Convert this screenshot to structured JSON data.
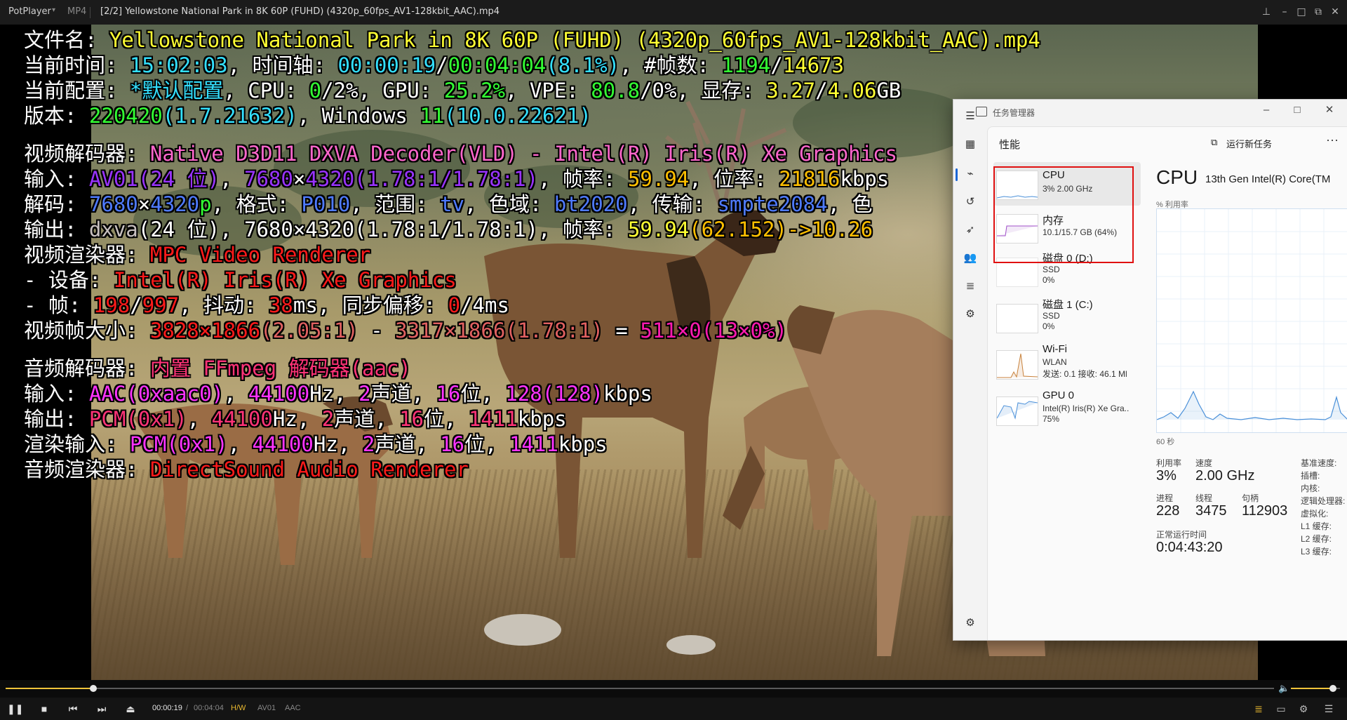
{
  "titlebar": {
    "app_name": "PotPlayer",
    "format": "MP4",
    "title": "[2/2] Yellowstone National Park in 8K 60P (FUHD) (4320p_60fps_AV1-128kbit_AAC).mp4"
  },
  "osd": {
    "filename": {
      "label": "文件名: ",
      "value": "Yellowstone National Park in 8K 60P (FUHD) (4320p_60fps_AV1-128kbit_AAC).mp4"
    },
    "time": {
      "label": "当前时间: ",
      "clock": "15:02:03",
      "sep1": ", 时间轴: ",
      "pos": "00:00:19",
      "slash": "/",
      "dur": "00:04:04",
      "pct": "(8.1%)",
      "sep2": ", #帧数: ",
      "frames": "1194",
      "slash2": "/",
      "total_frames": "14673"
    },
    "config": {
      "label": "当前配置: ",
      "preset": "*默认配置",
      "cpu_l": ", CPU: ",
      "cpu": "0",
      "cpu_s": "/2%",
      "gpu_l": ", GPU: ",
      "gpu": "25.2%",
      "vpe_l": ", VPE: ",
      "vpe": "80.8",
      "vpe_s": "/0%",
      "mem_l": ", 显存: ",
      "mem1": "3.27",
      "mem_sl": "/",
      "mem2": "4.06",
      "mem_u": "GB"
    },
    "version": {
      "label": "版本: ",
      "build": "220420",
      "ver": "(1.7.21632)",
      "os_l": ", Windows ",
      "os": "11",
      "os_ver": "(10.0.22621)"
    },
    "vdec": {
      "label": "视频解码器: ",
      "value": "Native D3D11 DXVA Decoder(VLD) - Intel(R) Iris(R) Xe Graphics"
    },
    "vin": {
      "label": "输入: ",
      "codec": "AV01",
      "bits": "(24 位)",
      "c1": ", ",
      "w": "7680",
      "x": "×",
      "h": "4320",
      "ar": "(1.78:1/1.78:1)",
      "fr_l": ", 帧率: ",
      "fr": "59.94",
      "br_l": ", 位率: ",
      "br": "21816",
      "br_u": "kbps"
    },
    "vdecode": {
      "label": "解码: ",
      "w": "7680",
      "x": "×",
      "h": "4320",
      "p": "p",
      "fmt_l": ", 格式: ",
      "fmt": "P010",
      "rng_l": ", 范围: ",
      "rng": "tv",
      "gam_l": ", 色域: ",
      "gam": "bt2020",
      "tr_l": ", 传输: ",
      "tr": "smpte2084",
      "tail": ", 色"
    },
    "vout": {
      "label": "输出: ",
      "fmt": "dxva",
      "rest": "(24 位), 7680×4320(1.78:1/1.78:1), 帧率: ",
      "fr": "59.94",
      "fr2": "(62.152)->10.26"
    },
    "vrend": {
      "label": "视频渲染器: ",
      "value": "MPC Video Renderer"
    },
    "device": {
      "label": " - 设备: ",
      "value": "Intel(R) Iris(R) Xe Graphics"
    },
    "frame": {
      "label": " - 帧: ",
      "v1": "198",
      "sl": "/",
      "v2": "997",
      "j_l": ", 抖动: ",
      "j": "38",
      "j_u": "ms",
      "s_l": ", 同步偏移: ",
      "s": "0",
      "s_r": "/4ms"
    },
    "fsize": {
      "label": "视频帧大小: ",
      "a": "3828×1866",
      "ar1": "(2.05:1)",
      "m": " - ",
      "b": "3317×1866",
      "ar2": "(1.78:1)",
      "eq": " = ",
      "c": "511×0",
      "d": "(13×0%)"
    },
    "adec": {
      "label": "音频解码器: ",
      "value": "内置 FFmpeg 解码器(aac)"
    },
    "ain": {
      "label": "输入: ",
      "codec": "AAC",
      "tag": "(0xaac0)",
      "c1": ", ",
      "hz": "44100",
      "hz_u": "Hz, ",
      "ch": "2",
      "ch_u": "声道, ",
      "bits": "16",
      "bits_u": "位, ",
      "br": "128",
      "br2": "(128)",
      "br_u": "kbps"
    },
    "aout": {
      "label": "输出: ",
      "fmt": "PCM",
      "tag": "(0x1)",
      "c1": ", ",
      "hz": "44100",
      "hz_u": "Hz, ",
      "ch": "2",
      "ch_u": "声道, ",
      "bits": "16",
      "bits_u": "位, ",
      "br": "1411",
      "br_u": "kbps"
    },
    "rin": {
      "label": "渲染输入: ",
      "fmt": "PCM",
      "tag": "(0x1)",
      "c1": ", ",
      "hz": "44100",
      "hz_u": "Hz, ",
      "ch": "2",
      "ch_u": "声道, ",
      "bits": "16",
      "bits_u": "位, ",
      "br": "1411",
      "br_u": "kbps"
    },
    "arend": {
      "label": "音频渲染器: ",
      "value": "DirectSound Audio Renderer"
    }
  },
  "taskmgr": {
    "title": "任务管理器",
    "perf_title": "性能",
    "new_task": "运行新任务",
    "more": "···",
    "resources": [
      {
        "name": "CPU",
        "line1": "3% 2.00 GHz",
        "line2": ""
      },
      {
        "name": "内存",
        "line1": "10.1/15.7 GB (64%)",
        "line2": ""
      },
      {
        "name": "磁盘 0 (D:)",
        "line1": "SSD",
        "line2": "0%"
      },
      {
        "name": "磁盘 1 (C:)",
        "line1": "SSD",
        "line2": "0%"
      },
      {
        "name": "Wi-Fi",
        "line1": "WLAN",
        "line2": "发送: 0.1 接收: 46.1 Ml"
      },
      {
        "name": "GPU 0",
        "line1": "Intel(R) Iris(R) Xe Gra..",
        "line2": "75%"
      }
    ],
    "detail": {
      "heading": "CPU",
      "cpu_name": "13th Gen Intel(R) Core(TM",
      "util_label": "% 利用率",
      "seconds": "60 秒",
      "util_lbl": "利用率",
      "util_val": "3%",
      "speed_lbl": "速度",
      "speed_val": "2.00 GHz",
      "proc_lbl": "进程",
      "proc_val": "228",
      "thread_lbl": "线程",
      "thread_val": "3475",
      "handle_lbl": "句柄",
      "handle_val": "112903",
      "uptime_lbl": "正常运行时间",
      "uptime_val": "0:04:43:20",
      "right_labels": [
        "基准速度:",
        "插槽:",
        "内核:",
        "逻辑处理器:",
        "虚拟化:",
        "L1 缓存:",
        "L2 缓存:",
        "L3 缓存:"
      ]
    }
  },
  "controls": {
    "time_current": "00:00:19",
    "time_sep": "/",
    "time_total": "00:04:04",
    "tag_hw": "H/W",
    "tag_video": "AV01",
    "tag_audio": "AAC",
    "seek_fraction": 0.069,
    "volume_fraction": 0.86
  },
  "colors": {
    "seek_accent": "#f0c33a",
    "highlight_box": "#e01010"
  }
}
